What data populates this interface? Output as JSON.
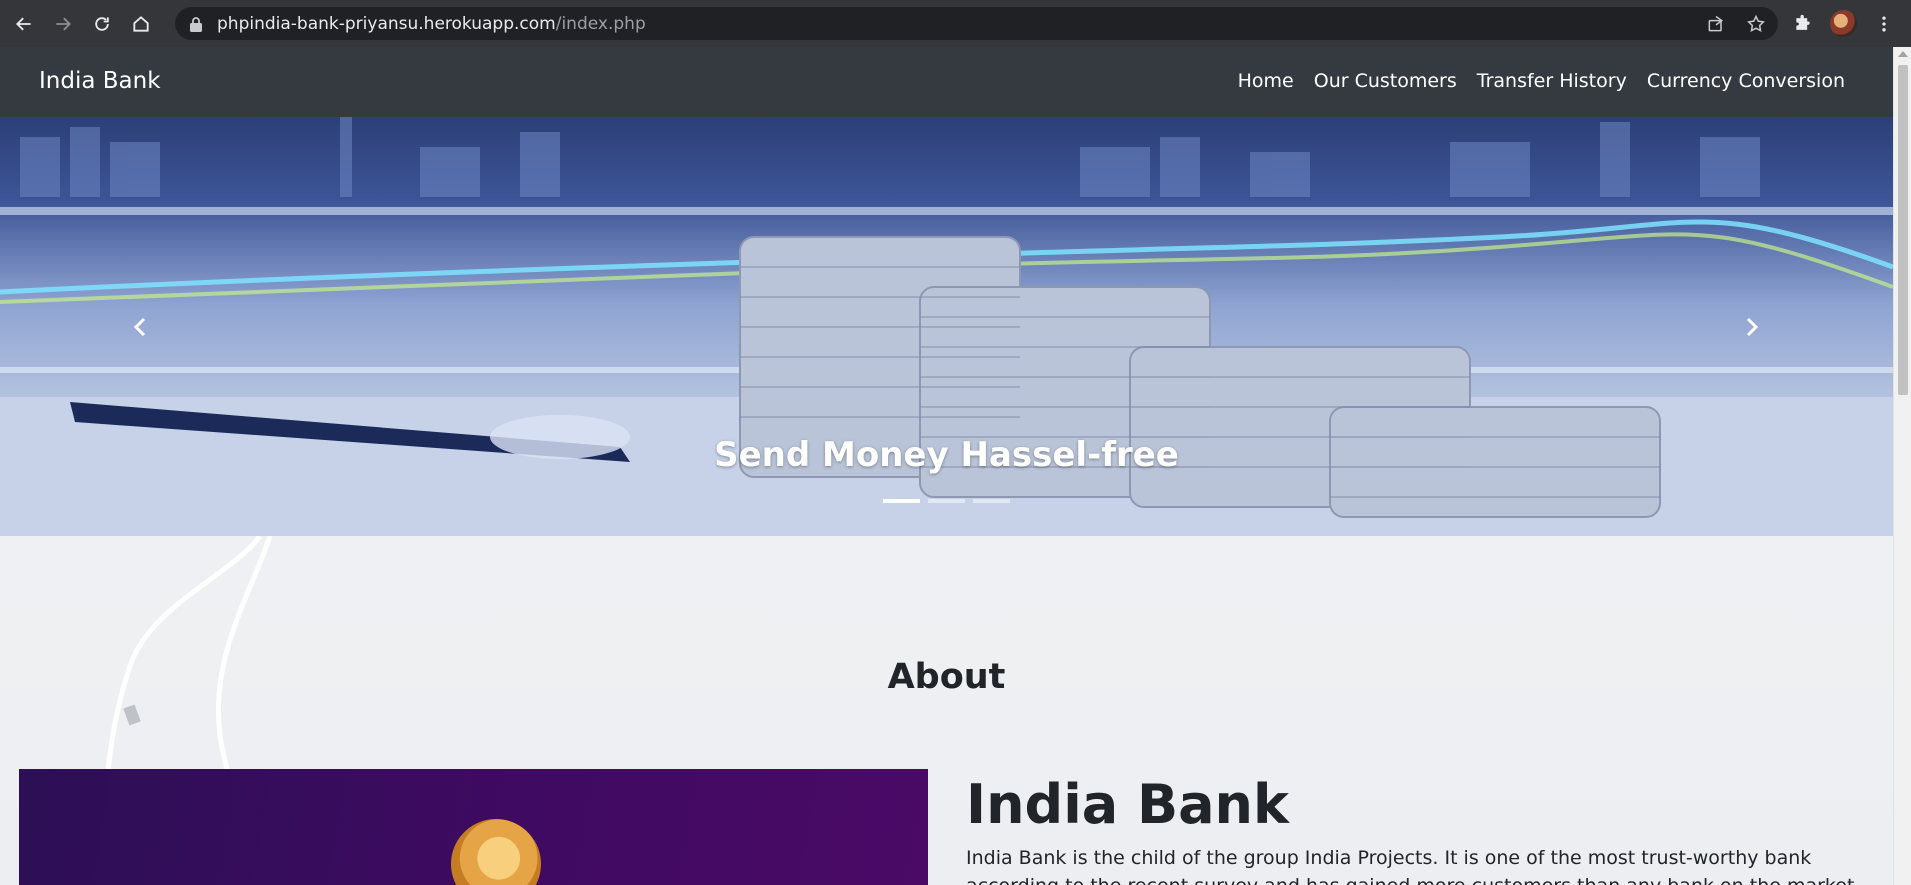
{
  "browser": {
    "url_host": "phpindia-bank-priyansu.herokuapp.com",
    "url_path": "/index.php"
  },
  "navbar": {
    "brand": "India Bank",
    "links": [
      "Home",
      "Our Customers",
      "Transfer History",
      "Currency Conversion"
    ]
  },
  "carousel": {
    "caption": "Send Money Hassel-free",
    "slide_count": 3,
    "active_index": 0
  },
  "about": {
    "section_title": "About",
    "heading": "India Bank",
    "description": "India Bank is the child of the group India Projects. It is one of the most trust-worthy bank according to the recent survey and has gained more customers than any bank on the market according to recent"
  },
  "colors": {
    "navbar_bg": "#343a40",
    "chrome_bg": "#35363a",
    "omnibox_bg": "#202124"
  }
}
